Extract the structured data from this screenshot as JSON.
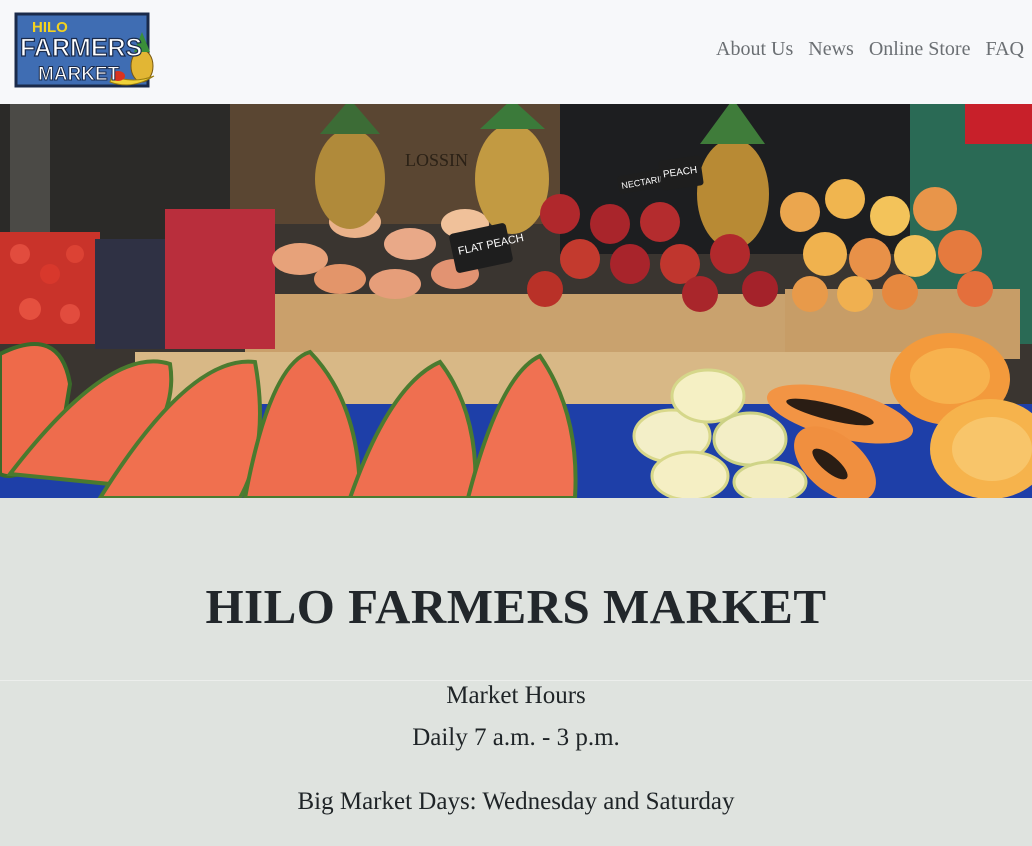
{
  "logo": {
    "line1": "HILO",
    "line2": "FARMERS",
    "line3": "MARKET"
  },
  "nav": {
    "items": [
      "About Us",
      "News",
      "Online Store",
      "FAQ"
    ]
  },
  "hero": {
    "sign1": "FLAT PEACH",
    "sign2": "NECTARINE",
    "sign3": "PEACH",
    "crate_text": "LOSSIN"
  },
  "main": {
    "title": "HILO FARMERS MARKET",
    "hours_label": "Market Hours",
    "hours_time": "Daily 7 a.m. - 3 p.m.",
    "big_days": "Big Market Days: Wednesday and Saturday"
  },
  "colors": {
    "header_bg": "#f7f8fa",
    "page_bg": "#dfe3df",
    "title_text": "#22272b",
    "nav_text": "#6b6f73",
    "logo_blue": "#3f6db3",
    "logo_yellow": "#f4d21f"
  }
}
